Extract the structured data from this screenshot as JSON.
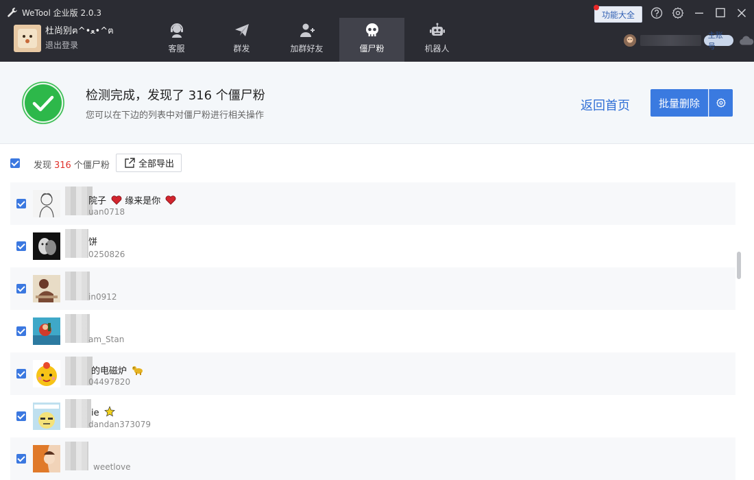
{
  "app": {
    "title": "WeTool 企业版 2.0.3"
  },
  "profile": {
    "name": "杜尚别ฅ^•ﻌ•^ฅ",
    "logout": "退出登录"
  },
  "nav": {
    "tabs": [
      {
        "label": "客服",
        "icon": "headset-icon"
      },
      {
        "label": "群发",
        "icon": "paper-plane-icon"
      },
      {
        "label": "加群好友",
        "icon": "add-user-icon"
      },
      {
        "label": "僵尸粉",
        "icon": "skull-icon",
        "active": true
      },
      {
        "label": "机器人",
        "icon": "robot-icon"
      }
    ]
  },
  "header_actions": {
    "feature_label": "功能大全",
    "account_badge": "主账号"
  },
  "result": {
    "title": "检测完成，发现了 316 个僵尸粉",
    "subtitle": "您可以在下边的列表中对僵尸粉进行相关操作",
    "back_label": "返回首页",
    "bulk_delete_label": "批量删除"
  },
  "toolbar": {
    "found_prefix": "发现",
    "found_count": "316",
    "found_suffix": "个僵尸粉",
    "export_label": "全部导出"
  },
  "contacts": [
    {
      "name": "院子",
      "id": "uan0718",
      "emoji": "heart"
    },
    {
      "name": "饼",
      "id": "0250826",
      "emoji": ""
    },
    {
      "name": "",
      "id": "in0912",
      "emoji": ""
    },
    {
      "name": "",
      "id": "am_Stan",
      "emoji": ""
    },
    {
      "name": "的电磁炉",
      "id": "04497820",
      "emoji": "dog"
    },
    {
      "name": "ie",
      "id": "dandan373079",
      "emoji": "star"
    },
    {
      "name": "",
      "id": "weetlove",
      "emoji": ""
    }
  ],
  "colors": {
    "header_bg": "#2b2c33",
    "accent": "#3a7ae0",
    "success": "#2db84a",
    "count_red": "#e0322c"
  }
}
